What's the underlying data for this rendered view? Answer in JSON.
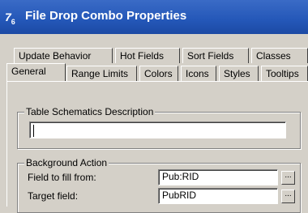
{
  "window": {
    "title": "File Drop Combo Properties",
    "icon_text": "7",
    "icon_sub": "6",
    "icon": "app-icon"
  },
  "tabs": {
    "row_back": [
      "Update Behavior",
      "Hot Fields",
      "Sort Fields",
      "Classes"
    ],
    "row_front": [
      "General",
      "Range Limits",
      "Colors",
      "Icons",
      "Styles",
      "Tooltips"
    ],
    "active": "General"
  },
  "general": {
    "table_schematics": {
      "title": "Table Schematics Description",
      "value": ""
    },
    "background_action": {
      "title": "Background Action",
      "field_to_fill_label": "Field to fill from:",
      "field_to_fill_value": "Pub:RID",
      "target_field_label": "Target field:",
      "target_field_value": "PubRID",
      "browse_label": "..."
    }
  }
}
